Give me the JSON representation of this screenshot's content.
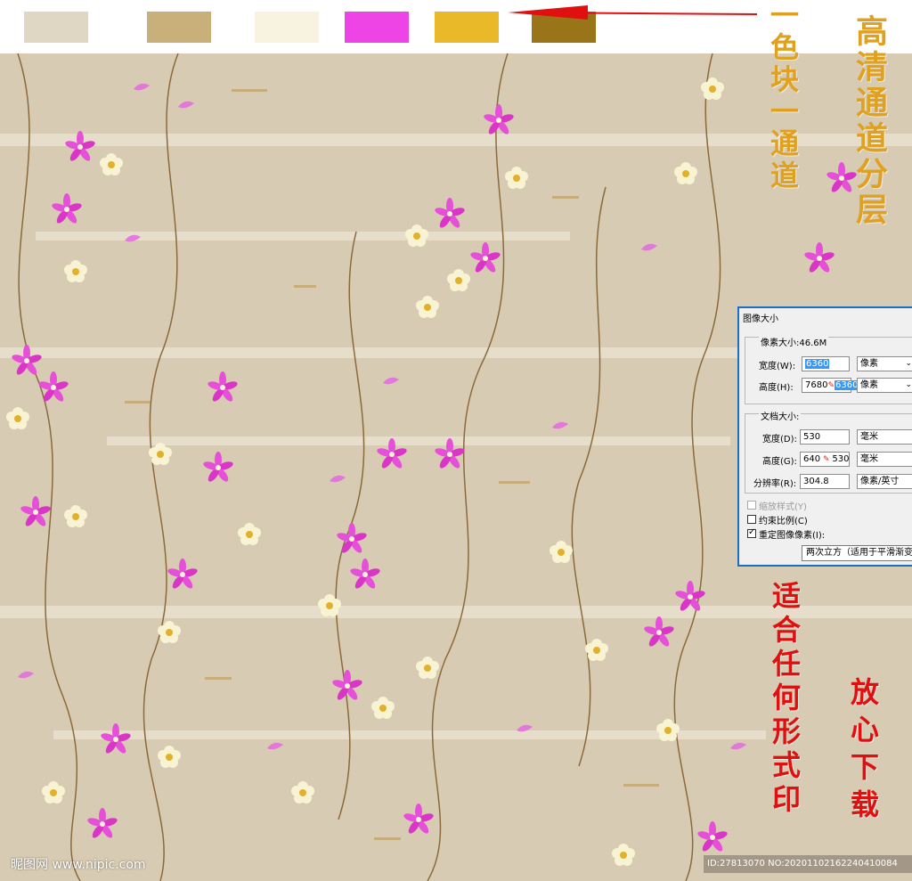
{
  "swatches": [
    {
      "name": "beige",
      "color": "#e0d6c4"
    },
    {
      "name": "tan",
      "color": "#c9af7a"
    },
    {
      "name": "cream",
      "color": "#f7f3e0"
    },
    {
      "name": "magenta",
      "color": "#ee44e6"
    },
    {
      "name": "gold",
      "color": "#eab929"
    },
    {
      "name": "brown",
      "color": "#9a7418"
    }
  ],
  "annotations": {
    "color_channels": "一色块一通道",
    "hd_layers": "高清通道分层",
    "suitable_print": "适合任何形式印",
    "download": "放心下载"
  },
  "dialog": {
    "title": "图像大小",
    "pixel_size": "像素大小:46.6M",
    "width_label": "宽度(W):",
    "width_value": "6360",
    "height_label": "高度(H):",
    "height_old": "7680",
    "height_value": "6360",
    "pixel_unit": "像素",
    "doc_size": "文档大小:",
    "doc_width_label": "宽度(D):",
    "doc_width_value": "530",
    "doc_height_label": "高度(G):",
    "doc_height_old": "640",
    "doc_height_value": "530",
    "mm_unit": "毫米",
    "resolution_label": "分辨率(R):",
    "resolution_value": "304.8",
    "resolution_unit": "像素/英寸",
    "scale_styles": "缩放样式(Y)",
    "constrain": "约束比例(C)",
    "resample": "重定图像像素(I):",
    "resample_method": "两次立方（适用于平滑渐变"
  },
  "watermark": "昵图网 www.nipic.com",
  "image_id": "ID:27813070 NO:20201102162240410084",
  "colors": {
    "background": "#d8cbb3",
    "annotation_gold": "#e0a020",
    "annotation_red": "#e01010",
    "arrow": "#e01010"
  }
}
